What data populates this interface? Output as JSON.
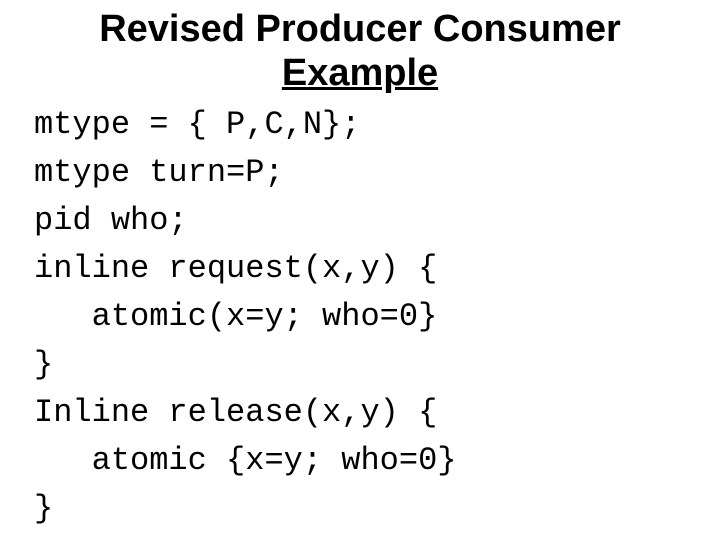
{
  "title": {
    "line1": "Revised Producer Consumer",
    "line2": "Example"
  },
  "code": {
    "l1": "mtype = { P,C,N};",
    "l2": "mtype turn=P;",
    "l3": "pid who;",
    "l4": "inline request(x,y) {",
    "l5": "   atomic(x=y; who=0}",
    "l6": "}",
    "l7": "Inline release(x,y) {",
    "l8": "   atomic {x=y; who=0}",
    "l9": "}"
  }
}
